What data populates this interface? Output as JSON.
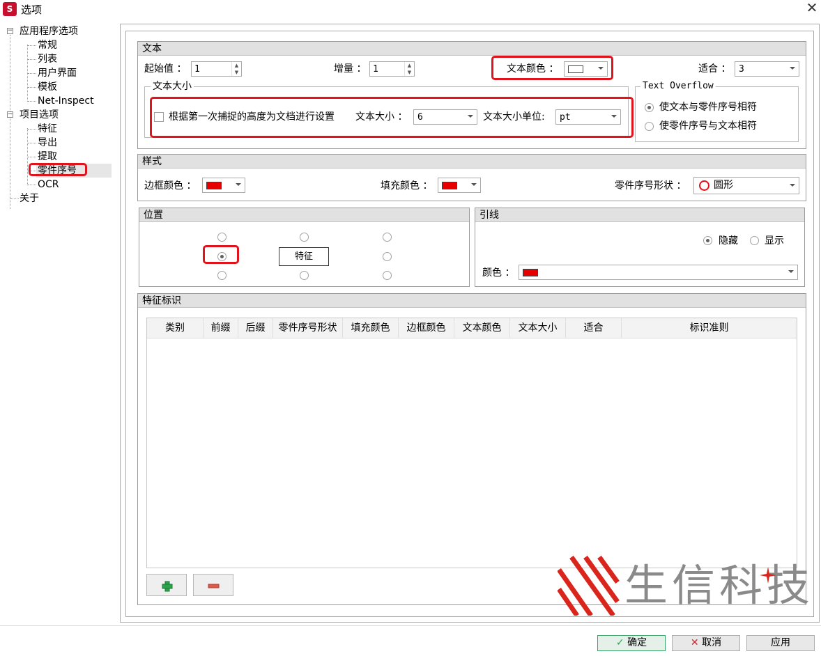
{
  "window": {
    "title": "选项",
    "app_icon_letter": "S",
    "close_glyph": "✕"
  },
  "tree": {
    "app_options": "应用程序选项",
    "app_children": [
      "常规",
      "列表",
      "用户界面",
      "模板",
      "Net-Inspect"
    ],
    "project_options": "项目选项",
    "project_children": [
      "特征",
      "导出",
      "提取",
      "零件序号",
      "OCR"
    ],
    "about": "关于",
    "toggle_glyph": "−",
    "selected": "零件序号"
  },
  "text_group": {
    "title": "文本",
    "start_label": "起始值 ：",
    "start_value": "1",
    "increment_label": "增量 ：",
    "increment_value": "1",
    "text_color_label": "文本颜色 ：",
    "text_color": "#ffffff",
    "fit_label": "适合 ：",
    "fit_value": "3",
    "text_size_section": "文本大小",
    "capture_height_label": "根据第一次捕捉的高度为文档进行设置",
    "size_label": "文本大小 ：",
    "size_value": "6",
    "unit_label": "文本大小单位:",
    "unit_value": "pt",
    "overflow_section": "Text Overflow",
    "overflow_option1": "使文本与零件序号相符",
    "overflow_option2": "使零件序号与文本相符"
  },
  "style_group": {
    "title": "样式",
    "border_color_label": "边框颜色 ：",
    "border_color": "#e60000",
    "fill_color_label": "填充颜色 ：",
    "fill_color": "#e60000",
    "shape_label": "零件序号形状 ：",
    "shape_value": "圆形",
    "shape_icon": "circle-icon"
  },
  "position_group": {
    "title": "位置",
    "center_label": "特征",
    "selected_position": "middle-left"
  },
  "leader_group": {
    "title": "引线",
    "hide_label": "隐藏",
    "show_label": "显示",
    "color_label": "颜色 ：",
    "color": "#e60000"
  },
  "feature_group": {
    "title": "特征标识",
    "columns": [
      "类别",
      "前缀",
      "后缀",
      "零件序号形状",
      "填充颜色",
      "边框颜色",
      "文本颜色",
      "文本大小",
      "适合",
      "标识准则"
    ],
    "rows": [],
    "add_icon": "plus-icon",
    "remove_icon": "minus-icon"
  },
  "footer": {
    "ok_label": "确定",
    "cancel_label": "取消",
    "apply_label": "应用"
  },
  "watermark": {
    "text": "生信科技"
  },
  "colors": {
    "highlight": "#e0141c",
    "plus": "#2aa44a",
    "minus": "#e05a4a",
    "ok_check": "#2c9e54",
    "cancel_x": "#d3202a",
    "watermark_red": "#d9251c"
  }
}
